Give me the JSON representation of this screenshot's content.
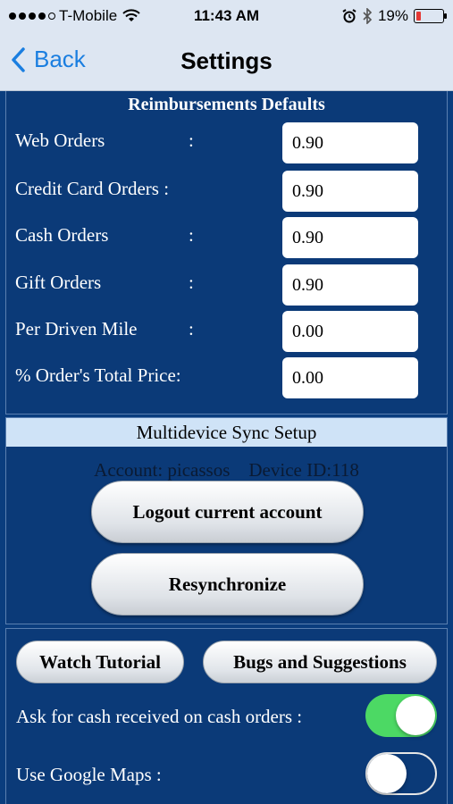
{
  "status_bar": {
    "carrier": "T-Mobile",
    "time": "11:43 AM",
    "battery": "19%",
    "battery_level": 0.19
  },
  "nav": {
    "back_label": "Back",
    "title": "Settings"
  },
  "reimbursements": {
    "title": "Reimbursements Defaults",
    "fields": [
      {
        "label": "Web Orders",
        "colon": ":",
        "value": "0.90"
      },
      {
        "label": "Credit Card Orders :",
        "colon": "",
        "value": "0.90"
      },
      {
        "label": "Cash Orders",
        "colon": ":",
        "value": "0.90"
      },
      {
        "label": "Gift Orders",
        "colon": ":",
        "value": "0.90"
      },
      {
        "label": "Per Driven Mile",
        "colon": ":",
        "value": "0.00"
      },
      {
        "label": "% Order's Total Price:",
        "colon": "",
        "value": "0.00"
      }
    ]
  },
  "sync": {
    "title": "Multidevice Sync Setup",
    "account_text": "Account: picassos    Device ID:118",
    "logout_label": "Logout current account",
    "resync_label": "Resynchronize"
  },
  "footer": {
    "tutorial_label": "Watch Tutorial",
    "bugs_label": "Bugs and Suggestions",
    "cash_toggle_label": "Ask for cash received on cash orders :",
    "cash_toggle_on": true,
    "maps_toggle_label": "Use Google Maps :",
    "maps_toggle_on": false
  },
  "colors": {
    "panel_bg": "#0b3a78",
    "toggle_on": "#4cd964",
    "link_blue": "#1a7ee0",
    "battery_low": "#e53935"
  }
}
